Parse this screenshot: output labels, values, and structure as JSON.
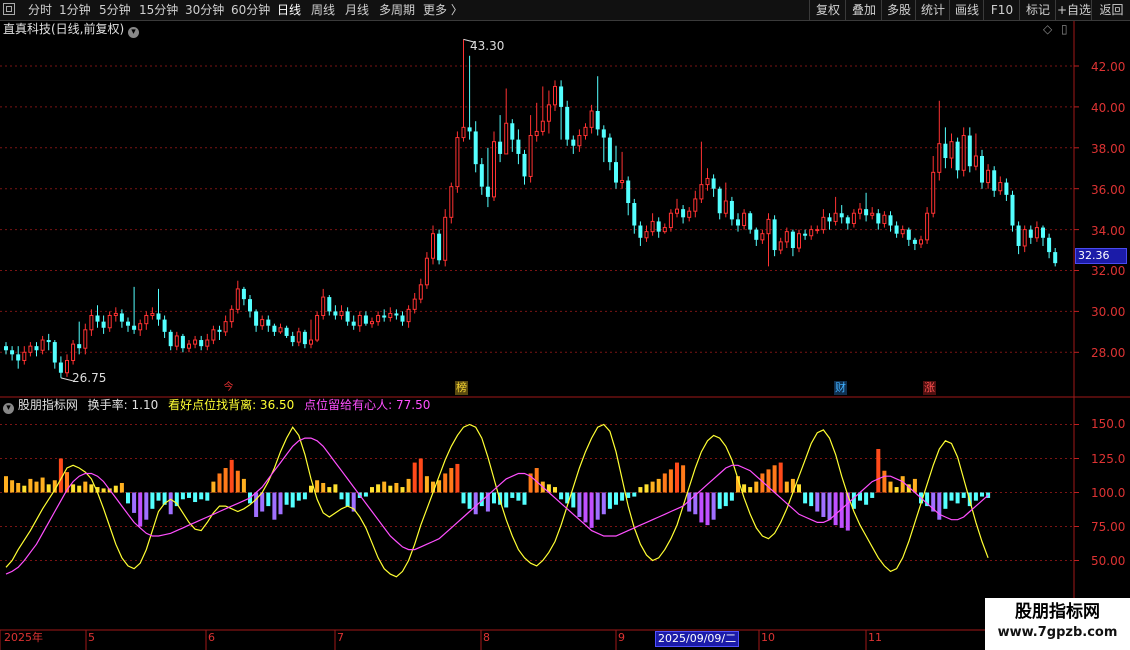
{
  "toolbar": {
    "periods": [
      {
        "label": "分时",
        "active": false
      },
      {
        "label": "1分钟",
        "active": false
      },
      {
        "label": "5分钟",
        "active": false
      },
      {
        "label": "15分钟",
        "active": false
      },
      {
        "label": "30分钟",
        "active": false
      },
      {
        "label": "60分钟",
        "active": false
      },
      {
        "label": "日线",
        "active": true
      },
      {
        "label": "周线",
        "active": false
      },
      {
        "label": "月线",
        "active": false
      },
      {
        "label": "多周期",
        "active": false
      }
    ],
    "more": "更多 〉",
    "right_buttons": [
      "复权",
      "叠加",
      "多股",
      "统计",
      "画线",
      "F10",
      "标记",
      "+自选",
      "返回"
    ]
  },
  "stock": {
    "title": "直真科技(日线,前复权)"
  },
  "price_axis": {
    "ticks": [
      "42.00",
      "40.00",
      "38.00",
      "36.00",
      "34.00",
      "32.00",
      "30.00",
      "28.00"
    ],
    "last_price": "32.36"
  },
  "annotations": {
    "high": "43.30",
    "low": "26.75"
  },
  "event_tags": [
    {
      "label": "今",
      "color": "#e03030"
    },
    {
      "label": "榜",
      "color": "#e8c020"
    },
    {
      "label": "财",
      "color": "#40b0ff"
    },
    {
      "label": "涨",
      "color": "#e03030"
    }
  ],
  "indicator": {
    "name": "股朋指标网",
    "turnover": "换手率: 1.10",
    "line1": "看好点位找背离: 36.50",
    "line2": "点位留给有心人: 77.50",
    "axis_ticks": [
      "150.0",
      "125.0",
      "100.0",
      "75.00",
      "50.00"
    ]
  },
  "date_axis": {
    "labels": [
      "2025年",
      "5",
      "6",
      "7",
      "8",
      "9",
      "10",
      "11"
    ],
    "cursor_date": "2025/09/09/二"
  },
  "watermark": {
    "line1": "股朋指标网",
    "line2": "www.7gpzb.com"
  },
  "colors": {
    "up": "#ff3232",
    "down": "#54ffff",
    "yellow_line": "#ffff33",
    "magenta_line": "#ff4fff"
  },
  "chart_data": {
    "type": "candlestick",
    "price_range": [
      26.0,
      43.5
    ],
    "candles": [
      [
        28.3,
        28.1,
        28.5,
        27.9
      ],
      [
        28.1,
        27.9,
        28.3,
        27.6
      ],
      [
        27.9,
        27.6,
        28.3,
        27.2
      ],
      [
        27.6,
        28.0,
        28.3,
        27.4
      ],
      [
        28.0,
        28.3,
        28.5,
        27.8
      ],
      [
        28.3,
        28.1,
        28.5,
        27.8
      ],
      [
        28.1,
        28.6,
        28.8,
        27.9
      ],
      [
        28.6,
        28.5,
        28.9,
        28.1
      ],
      [
        28.5,
        27.5,
        28.6,
        27.2
      ],
      [
        27.5,
        27.0,
        27.8,
        26.75
      ],
      [
        27.0,
        27.6,
        27.9,
        26.8
      ],
      [
        27.6,
        28.4,
        28.6,
        27.4
      ],
      [
        28.4,
        28.2,
        29.5,
        27.9
      ],
      [
        28.2,
        29.1,
        29.4,
        27.9
      ],
      [
        29.1,
        29.8,
        30.1,
        28.8
      ],
      [
        29.8,
        29.5,
        30.3,
        29.2
      ],
      [
        29.5,
        29.2,
        29.8,
        28.9
      ],
      [
        29.2,
        29.8,
        30.0,
        29.0
      ],
      [
        29.8,
        29.9,
        30.2,
        29.5
      ],
      [
        29.9,
        29.5,
        30.1,
        29.2
      ],
      [
        29.5,
        29.3,
        29.7,
        29.0
      ],
      [
        29.3,
        29.1,
        31.2,
        28.9
      ],
      [
        29.1,
        29.4,
        29.6,
        28.8
      ],
      [
        29.4,
        29.8,
        30.0,
        29.1
      ],
      [
        29.8,
        29.9,
        30.2,
        29.6
      ],
      [
        29.9,
        29.6,
        31.1,
        29.3
      ],
      [
        29.6,
        29.0,
        29.8,
        28.7
      ],
      [
        29.0,
        28.3,
        29.1,
        28.1
      ],
      [
        28.3,
        28.8,
        29.0,
        28.1
      ],
      [
        28.8,
        28.2,
        28.9,
        28.0
      ],
      [
        28.2,
        28.4,
        28.6,
        28.0
      ],
      [
        28.4,
        28.6,
        28.8,
        28.2
      ],
      [
        28.6,
        28.3,
        28.8,
        28.1
      ],
      [
        28.3,
        28.6,
        28.9,
        28.1
      ],
      [
        28.6,
        29.1,
        29.3,
        28.4
      ],
      [
        29.1,
        29.0,
        29.3,
        28.6
      ],
      [
        29.0,
        29.5,
        29.8,
        28.8
      ],
      [
        29.5,
        30.1,
        30.3,
        29.2
      ],
      [
        30.1,
        31.1,
        31.5,
        29.9
      ],
      [
        31.1,
        30.6,
        31.2,
        30.3
      ],
      [
        30.6,
        30.0,
        30.8,
        29.7
      ],
      [
        30.0,
        29.3,
        30.1,
        29.0
      ],
      [
        29.3,
        29.6,
        29.8,
        29.1
      ],
      [
        29.6,
        29.3,
        29.8,
        29.0
      ],
      [
        29.3,
        29.0,
        29.4,
        28.8
      ],
      [
        29.0,
        29.2,
        29.4,
        28.9
      ],
      [
        29.2,
        28.8,
        29.3,
        28.7
      ],
      [
        28.8,
        28.5,
        29.0,
        28.3
      ],
      [
        28.5,
        29.0,
        29.2,
        28.3
      ],
      [
        29.0,
        28.4,
        29.1,
        28.2
      ],
      [
        28.4,
        28.6,
        29.6,
        28.2
      ],
      [
        28.6,
        29.8,
        30.0,
        28.5
      ],
      [
        29.8,
        30.7,
        31.1,
        29.6
      ],
      [
        30.7,
        30.0,
        30.8,
        29.8
      ],
      [
        30.0,
        29.8,
        30.3,
        29.6
      ],
      [
        29.8,
        30.0,
        30.3,
        29.6
      ],
      [
        30.0,
        29.5,
        30.2,
        29.3
      ],
      [
        29.5,
        29.3,
        29.8,
        29.1
      ],
      [
        29.3,
        29.8,
        30.0,
        29.0
      ],
      [
        29.8,
        29.4,
        30.0,
        29.3
      ],
      [
        29.4,
        29.5,
        29.7,
        29.2
      ],
      [
        29.5,
        29.8,
        30.0,
        29.3
      ],
      [
        29.8,
        29.7,
        30.1,
        29.5
      ],
      [
        29.7,
        29.9,
        30.2,
        29.5
      ],
      [
        29.9,
        29.8,
        30.1,
        29.6
      ],
      [
        29.8,
        29.5,
        30.0,
        29.3
      ],
      [
        29.5,
        30.1,
        30.3,
        29.2
      ],
      [
        30.1,
        30.6,
        30.9,
        29.9
      ],
      [
        30.6,
        31.3,
        31.6,
        30.4
      ],
      [
        31.3,
        32.6,
        32.9,
        31.1
      ],
      [
        32.6,
        33.8,
        34.2,
        32.3
      ],
      [
        33.8,
        32.5,
        34.0,
        32.3
      ],
      [
        32.5,
        34.6,
        35.0,
        32.2
      ],
      [
        34.6,
        36.1,
        36.3,
        34.3
      ],
      [
        36.1,
        38.5,
        38.8,
        35.8
      ],
      [
        38.5,
        39.0,
        43.3,
        38.3
      ],
      [
        39.0,
        38.8,
        42.5,
        38.4
      ],
      [
        38.8,
        37.2,
        39.3,
        36.8
      ],
      [
        37.2,
        36.1,
        37.5,
        35.7
      ],
      [
        36.1,
        35.6,
        38.0,
        35.1
      ],
      [
        35.6,
        38.3,
        38.8,
        35.4
      ],
      [
        38.3,
        37.7,
        39.6,
        37.3
      ],
      [
        37.7,
        39.2,
        40.9,
        38.9
      ],
      [
        39.2,
        38.4,
        39.4,
        37.8
      ],
      [
        38.4,
        37.7,
        38.9,
        37.2
      ],
      [
        37.7,
        36.6,
        37.9,
        36.2
      ],
      [
        36.6,
        38.6,
        39.6,
        36.3
      ],
      [
        38.6,
        38.8,
        40.2,
        38.3
      ],
      [
        38.8,
        39.3,
        41.0,
        38.6
      ],
      [
        39.3,
        40.1,
        40.8,
        38.7
      ],
      [
        40.1,
        41.0,
        41.3,
        39.8
      ],
      [
        41.0,
        40.0,
        41.3,
        38.4
      ],
      [
        40.0,
        38.4,
        40.3,
        38.1
      ],
      [
        38.4,
        38.1,
        38.6,
        37.7
      ],
      [
        38.1,
        38.6,
        38.9,
        37.8
      ],
      [
        38.6,
        39.0,
        39.2,
        38.4
      ],
      [
        39.0,
        39.8,
        40.1,
        38.7
      ],
      [
        39.8,
        38.9,
        41.5,
        38.6
      ],
      [
        38.9,
        38.5,
        39.1,
        37.3
      ],
      [
        38.5,
        37.3,
        38.7,
        36.9
      ],
      [
        37.3,
        36.3,
        38.1,
        36.0
      ],
      [
        36.3,
        36.4,
        37.8,
        36.0
      ],
      [
        36.4,
        35.3,
        36.6,
        34.7
      ],
      [
        35.3,
        34.2,
        35.5,
        33.8
      ],
      [
        34.2,
        33.6,
        34.4,
        33.2
      ],
      [
        33.6,
        33.9,
        34.2,
        33.4
      ],
      [
        33.9,
        34.4,
        34.8,
        33.7
      ],
      [
        34.4,
        33.9,
        34.6,
        33.6
      ],
      [
        33.9,
        34.1,
        34.3,
        33.8
      ],
      [
        34.1,
        34.8,
        35.0,
        33.9
      ],
      [
        34.8,
        35.0,
        35.5,
        34.6
      ],
      [
        35.0,
        34.6,
        35.2,
        34.3
      ],
      [
        34.6,
        34.9,
        35.1,
        34.4
      ],
      [
        34.9,
        35.5,
        35.9,
        34.6
      ],
      [
        35.5,
        36.2,
        38.3,
        35.3
      ],
      [
        36.2,
        36.5,
        37.0,
        35.9
      ],
      [
        36.5,
        36.0,
        36.7,
        35.6
      ],
      [
        36.0,
        34.8,
        36.1,
        34.5
      ],
      [
        34.8,
        35.4,
        36.3,
        34.6
      ],
      [
        35.4,
        34.5,
        35.6,
        34.2
      ],
      [
        34.5,
        34.2,
        34.8,
        33.9
      ],
      [
        34.2,
        34.8,
        35.0,
        34.0
      ],
      [
        34.8,
        34.0,
        34.9,
        33.8
      ],
      [
        34.0,
        33.5,
        34.1,
        33.2
      ],
      [
        33.5,
        33.8,
        34.0,
        33.3
      ],
      [
        33.8,
        34.5,
        34.8,
        32.2
      ],
      [
        34.5,
        33.0,
        34.7,
        32.7
      ],
      [
        33.0,
        33.4,
        33.6,
        32.8
      ],
      [
        33.4,
        33.9,
        34.1,
        33.1
      ],
      [
        33.9,
        33.1,
        34.0,
        32.7
      ],
      [
        33.1,
        33.8,
        34.0,
        32.9
      ],
      [
        33.8,
        33.7,
        34.0,
        33.5
      ],
      [
        33.7,
        34.0,
        34.2,
        33.5
      ],
      [
        34.0,
        34.0,
        34.2,
        33.8
      ],
      [
        34.0,
        34.6,
        35.0,
        33.8
      ],
      [
        34.6,
        34.4,
        34.8,
        34.0
      ],
      [
        34.4,
        34.8,
        35.6,
        34.2
      ],
      [
        34.8,
        34.6,
        35.2,
        34.3
      ],
      [
        34.6,
        34.3,
        34.7,
        34.0
      ],
      [
        34.3,
        34.8,
        35.0,
        34.1
      ],
      [
        34.8,
        35.0,
        35.3,
        34.5
      ],
      [
        35.0,
        34.7,
        35.8,
        34.4
      ],
      [
        34.7,
        34.8,
        35.1,
        34.5
      ],
      [
        34.8,
        34.3,
        35.0,
        34.0
      ],
      [
        34.3,
        34.7,
        34.9,
        34.1
      ],
      [
        34.7,
        34.2,
        34.9,
        33.9
      ],
      [
        34.2,
        33.8,
        34.4,
        33.6
      ],
      [
        33.8,
        34.0,
        34.2,
        33.6
      ],
      [
        34.0,
        33.5,
        34.1,
        33.2
      ],
      [
        33.5,
        33.3,
        33.6,
        33.0
      ],
      [
        33.3,
        33.5,
        33.7,
        33.1
      ],
      [
        33.5,
        34.8,
        35.1,
        33.3
      ],
      [
        34.8,
        36.8,
        37.6,
        34.6
      ],
      [
        36.8,
        38.2,
        40.3,
        36.4
      ],
      [
        38.2,
        37.5,
        39.0,
        37.0
      ],
      [
        37.5,
        38.3,
        38.7,
        37.0
      ],
      [
        38.3,
        36.9,
        38.5,
        36.5
      ],
      [
        36.9,
        38.6,
        39.0,
        36.6
      ],
      [
        38.6,
        37.1,
        39.0,
        36.8
      ],
      [
        37.1,
        37.6,
        38.7,
        36.9
      ],
      [
        37.6,
        36.3,
        37.9,
        36.0
      ],
      [
        36.3,
        36.9,
        37.2,
        36.0
      ],
      [
        36.9,
        35.9,
        37.1,
        35.6
      ],
      [
        35.9,
        36.3,
        36.6,
        35.7
      ],
      [
        36.3,
        35.7,
        36.5,
        35.4
      ],
      [
        35.7,
        34.2,
        35.9,
        33.9
      ],
      [
        34.2,
        33.2,
        34.4,
        32.8
      ],
      [
        33.2,
        34.0,
        34.2,
        32.9
      ],
      [
        34.0,
        33.6,
        34.2,
        33.3
      ],
      [
        33.6,
        34.1,
        34.4,
        33.4
      ],
      [
        34.1,
        33.6,
        34.2,
        33.2
      ],
      [
        33.6,
        32.9,
        33.8,
        32.6
      ],
      [
        32.9,
        32.36,
        33.1,
        32.2
      ]
    ],
    "turnover_bars": [
      12,
      9,
      7,
      5,
      10,
      8,
      11,
      6,
      9,
      25,
      15,
      6,
      5,
      8,
      6,
      4,
      3,
      3,
      5,
      7,
      -8,
      -15,
      -25,
      -20,
      -12,
      -6,
      -9,
      -16,
      -10,
      -5,
      -4,
      -7,
      -5,
      -6,
      8,
      14,
      18,
      24,
      16,
      10,
      -8,
      -18,
      -14,
      -10,
      -20,
      -16,
      -9,
      -11,
      -6,
      -5,
      5,
      9,
      7,
      4,
      6,
      -5,
      -10,
      -14,
      -4,
      -3,
      4,
      6,
      8,
      5,
      7,
      4,
      10,
      22,
      25,
      12,
      8,
      9,
      14,
      18,
      21,
      -8,
      -12,
      -16,
      -10,
      -14,
      -8,
      -9,
      -11,
      -4,
      -6,
      -9,
      14,
      18,
      8,
      6,
      4,
      -5,
      -8,
      -11,
      -18,
      -22,
      -26,
      -20,
      -16,
      -12,
      -9,
      -6,
      -4,
      -3,
      4,
      6,
      8,
      10,
      14,
      17,
      22,
      20,
      -14,
      -16,
      -22,
      -24,
      -20,
      -12,
      -10,
      -6,
      12,
      6,
      4,
      8,
      14,
      17,
      20,
      22,
      8,
      10,
      6,
      -8,
      -10,
      -14,
      -18,
      -20,
      -24,
      -26,
      -28,
      -12,
      -6,
      -9,
      -4,
      32,
      16,
      8,
      4,
      12,
      6,
      10,
      -8,
      -10,
      -14,
      -20,
      -12,
      -6,
      -8,
      -4,
      -10,
      -6,
      -3,
      -4
    ],
    "yellow_series": [
      45,
      50,
      58,
      65,
      72,
      80,
      88,
      95,
      102,
      110,
      118,
      120,
      118,
      115,
      110,
      100,
      88,
      75,
      62,
      52,
      46,
      44,
      48,
      58,
      72,
      86,
      92,
      95,
      92,
      85,
      78,
      73,
      72,
      78,
      85,
      90,
      90,
      88,
      86,
      88,
      91,
      95,
      100,
      108,
      118,
      130,
      140,
      148,
      142,
      128,
      110,
      95,
      85,
      82,
      85,
      88,
      90,
      88,
      82,
      74,
      63,
      52,
      44,
      40,
      38,
      42,
      50,
      62,
      76,
      88,
      100,
      112,
      124,
      134,
      142,
      148,
      150,
      148,
      140,
      126,
      110,
      94,
      80,
      68,
      58,
      52,
      48,
      46,
      50,
      56,
      64,
      76,
      90,
      104,
      118,
      130,
      140,
      148,
      150,
      145,
      130,
      110,
      90,
      74,
      62,
      54,
      50,
      52,
      58,
      66,
      76,
      90,
      104,
      118,
      130,
      138,
      142,
      140,
      134,
      124,
      110,
      96,
      84,
      74,
      68,
      66,
      70,
      78,
      88,
      100,
      112,
      124,
      136,
      144,
      146,
      140,
      128,
      112,
      98,
      86,
      76,
      68,
      60,
      52,
      46,
      42,
      44,
      52,
      64,
      78,
      92,
      106,
      120,
      132,
      138,
      136,
      126,
      110,
      94,
      78,
      64,
      52
    ],
    "magenta_series": [
      40,
      42,
      45,
      50,
      56,
      62,
      70,
      78,
      86,
      94,
      102,
      108,
      112,
      114,
      114,
      112,
      108,
      102,
      96,
      90,
      84,
      78,
      74,
      70,
      68,
      68,
      69,
      70,
      72,
      74,
      76,
      78,
      80,
      82,
      84,
      86,
      88,
      90,
      92,
      94,
      96,
      100,
      104,
      110,
      116,
      122,
      128,
      134,
      138,
      140,
      140,
      138,
      134,
      128,
      122,
      116,
      110,
      104,
      98,
      92,
      86,
      80,
      74,
      68,
      64,
      60,
      58,
      58,
      60,
      62,
      64,
      66,
      70,
      74,
      78,
      82,
      86,
      90,
      94,
      98,
      102,
      106,
      110,
      112,
      114,
      114,
      112,
      108,
      104,
      100,
      96,
      92,
      88,
      84,
      80,
      76,
      72,
      70,
      68,
      68,
      68,
      70,
      72,
      74,
      76,
      78,
      80,
      82,
      84,
      86,
      88,
      90,
      94,
      98,
      102,
      106,
      110,
      114,
      118,
      120,
      120,
      118,
      116,
      112,
      108,
      104,
      100,
      96,
      92,
      88,
      84,
      82,
      80,
      78,
      78,
      80,
      84,
      88,
      92,
      96,
      100,
      104,
      108,
      110,
      112,
      112,
      110,
      108,
      104,
      100,
      96,
      92,
      88,
      84,
      82,
      80,
      80,
      82,
      86,
      90,
      94,
      98
    ]
  }
}
